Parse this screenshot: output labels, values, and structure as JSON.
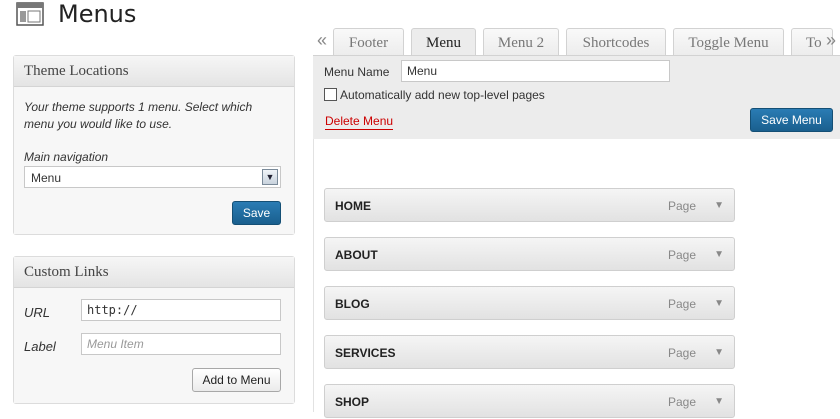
{
  "page": {
    "title": "Menus"
  },
  "theme_locations": {
    "heading": "Theme Locations",
    "description": "Your theme supports 1 menu. Select which menu you would like to use.",
    "main_nav_label": "Main navigation",
    "selected_menu": "Menu",
    "save_label": "Save"
  },
  "custom_links": {
    "heading": "Custom Links",
    "url_label": "URL",
    "url_value": "http://",
    "label_label": "Label",
    "label_placeholder": "Menu Item",
    "add_button": "Add to Menu"
  },
  "tabs": {
    "left_arrow": "«",
    "right_arrow": "»",
    "items": [
      "Footer",
      "Menu",
      "Menu 2",
      "Shortcodes",
      "Toggle Menu",
      "To"
    ],
    "active": "Menu"
  },
  "menu_editor": {
    "name_label": "Menu Name",
    "name_value": "Menu",
    "auto_add_label": "Automatically add new top-level pages",
    "auto_add_checked": false,
    "delete_label": "Delete Menu",
    "save_label": "Save Menu"
  },
  "menu_items": [
    {
      "title": "HOME",
      "type": "Page"
    },
    {
      "title": "ABOUT",
      "type": "Page"
    },
    {
      "title": "BLOG",
      "type": "Page"
    },
    {
      "title": "SERVICES",
      "type": "Page"
    },
    {
      "title": "SHOP",
      "type": "Page"
    }
  ],
  "colors": {
    "accent": "#21759b",
    "delete": "#cc0000"
  }
}
